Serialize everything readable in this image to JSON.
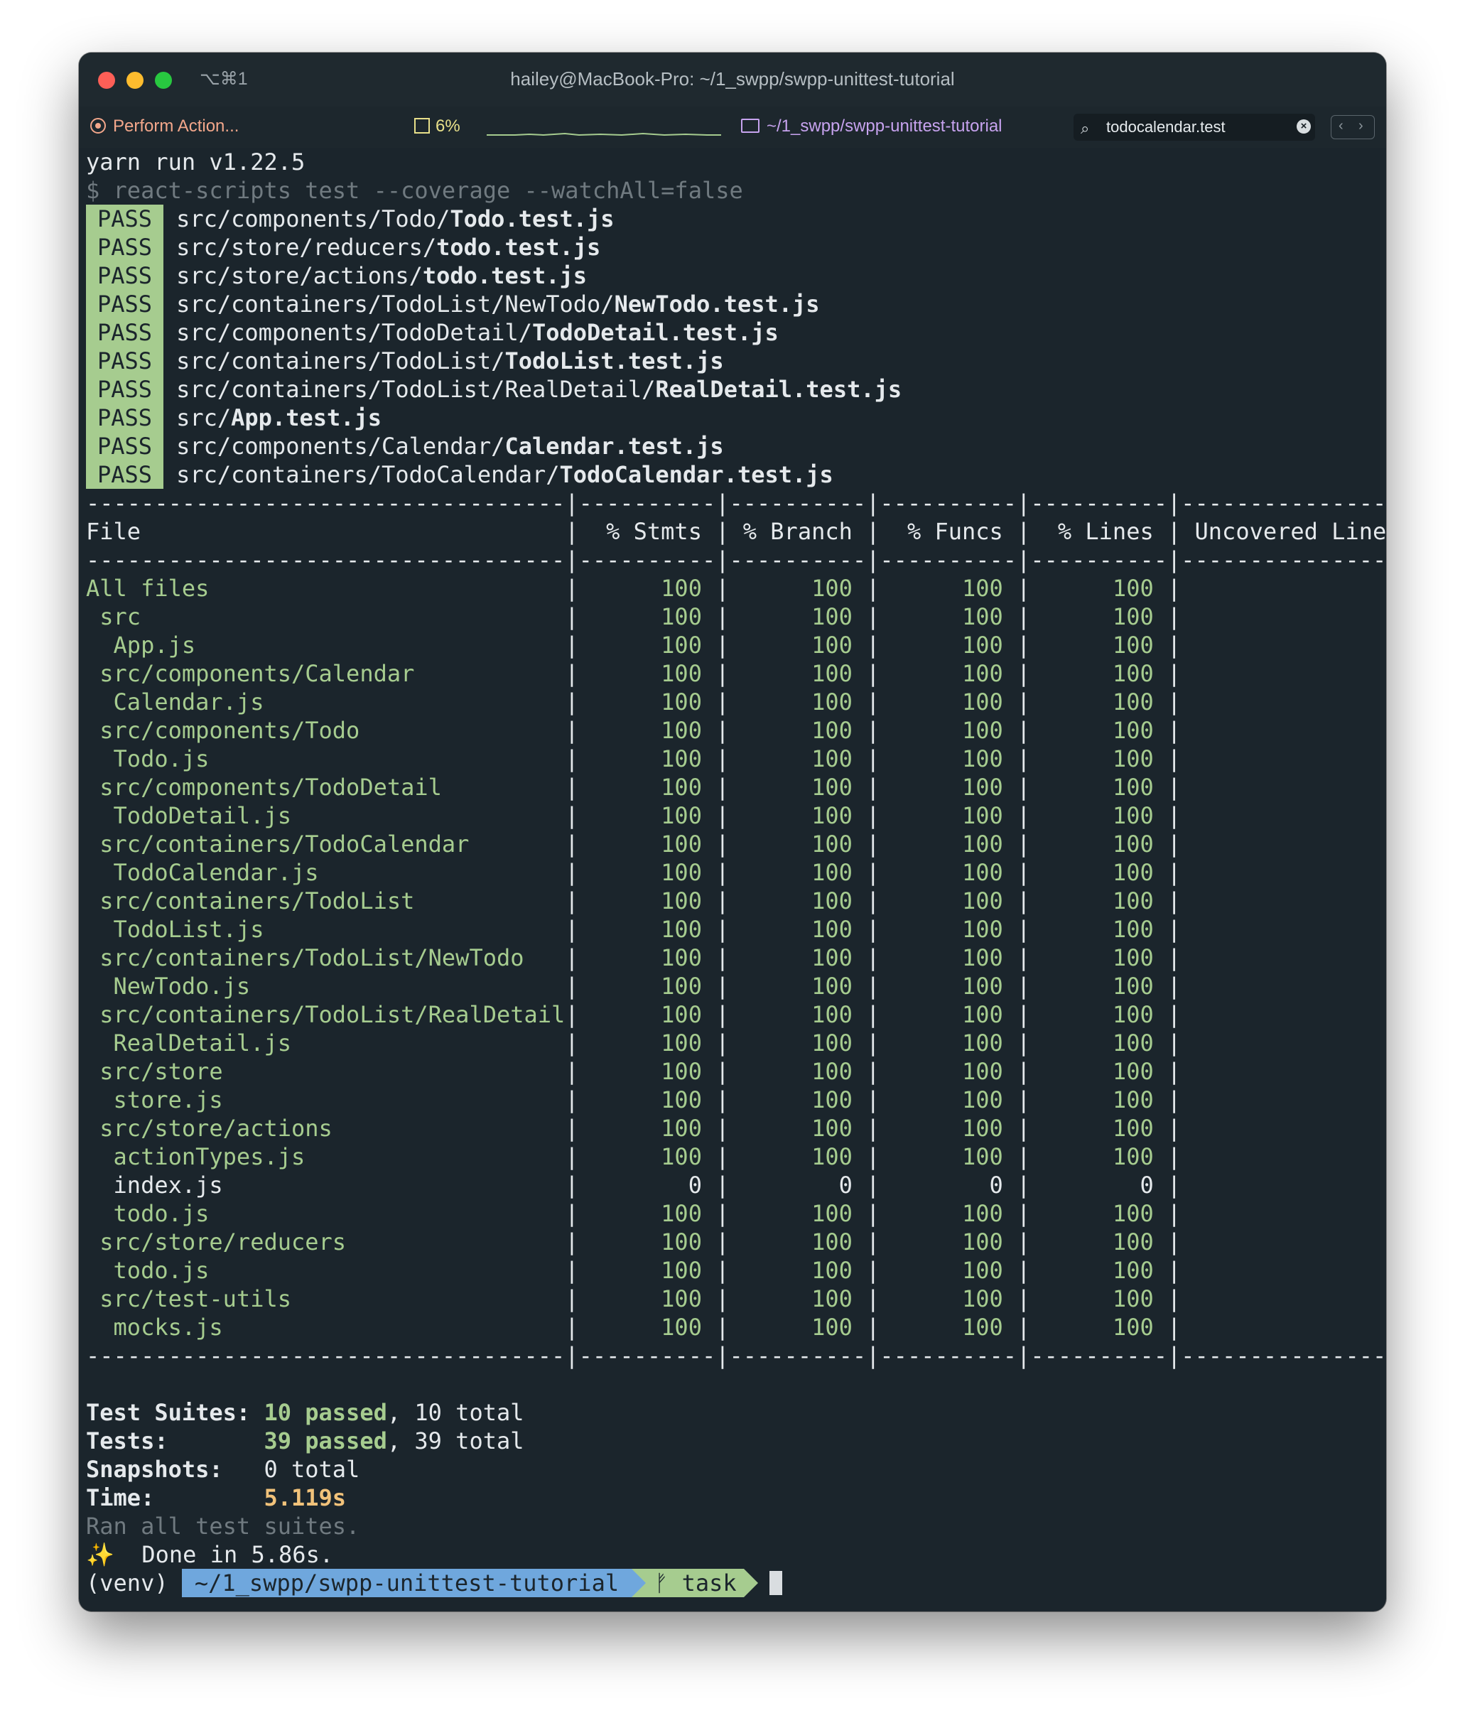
{
  "window": {
    "shortcut": "⌥⌘1",
    "title": "hailey@MacBook-Pro: ~/1_swpp/swpp-unittest-tutorial"
  },
  "statusbar": {
    "action": "Perform Action...",
    "cpu": "6%",
    "path": "~/1_swpp/swpp-unittest-tutorial",
    "search_value": "todocalendar.test"
  },
  "terminal": {
    "yarn_line": "yarn run v1.22.5",
    "command": "$ react-scripts test --coverage --watchAll=false",
    "pass_label": "PASS",
    "tests": [
      {
        "dir": "src/components/Todo/",
        "file": "Todo.test.js"
      },
      {
        "dir": "src/store/reducers/",
        "file": "todo.test.js"
      },
      {
        "dir": "src/store/actions/",
        "file": "todo.test.js"
      },
      {
        "dir": "src/containers/TodoList/NewTodo/",
        "file": "NewTodo.test.js"
      },
      {
        "dir": "src/components/TodoDetail/",
        "file": "TodoDetail.test.js"
      },
      {
        "dir": "src/containers/TodoList/",
        "file": "TodoList.test.js"
      },
      {
        "dir": "src/containers/TodoList/RealDetail/",
        "file": "RealDetail.test.js"
      },
      {
        "dir": "src/",
        "file": "App.test.js"
      },
      {
        "dir": "src/components/Calendar/",
        "file": "Calendar.test.js"
      },
      {
        "dir": "src/containers/TodoCalendar/",
        "file": "TodoCalendar.test.js"
      }
    ],
    "table": {
      "headers": [
        "File",
        "% Stmts",
        "% Branch",
        "% Funcs",
        "% Lines",
        "Uncovered Line #s"
      ],
      "rows": [
        {
          "name": "All files",
          "indent": 0,
          "v": [
            "100",
            "100",
            "100",
            "100"
          ]
        },
        {
          "name": "src",
          "indent": 1,
          "v": [
            "100",
            "100",
            "100",
            "100"
          ]
        },
        {
          "name": "App.js",
          "indent": 2,
          "v": [
            "100",
            "100",
            "100",
            "100"
          ]
        },
        {
          "name": "src/components/Calendar",
          "indent": 1,
          "v": [
            "100",
            "100",
            "100",
            "100"
          ]
        },
        {
          "name": "Calendar.js",
          "indent": 2,
          "v": [
            "100",
            "100",
            "100",
            "100"
          ]
        },
        {
          "name": "src/components/Todo",
          "indent": 1,
          "v": [
            "100",
            "100",
            "100",
            "100"
          ]
        },
        {
          "name": "Todo.js",
          "indent": 2,
          "v": [
            "100",
            "100",
            "100",
            "100"
          ]
        },
        {
          "name": "src/components/TodoDetail",
          "indent": 1,
          "v": [
            "100",
            "100",
            "100",
            "100"
          ]
        },
        {
          "name": "TodoDetail.js",
          "indent": 2,
          "v": [
            "100",
            "100",
            "100",
            "100"
          ]
        },
        {
          "name": "src/containers/TodoCalendar",
          "indent": 1,
          "v": [
            "100",
            "100",
            "100",
            "100"
          ]
        },
        {
          "name": "TodoCalendar.js",
          "indent": 2,
          "v": [
            "100",
            "100",
            "100",
            "100"
          ]
        },
        {
          "name": "src/containers/TodoList",
          "indent": 1,
          "v": [
            "100",
            "100",
            "100",
            "100"
          ]
        },
        {
          "name": "TodoList.js",
          "indent": 2,
          "v": [
            "100",
            "100",
            "100",
            "100"
          ]
        },
        {
          "name": "src/containers/TodoList/NewTodo",
          "indent": 1,
          "v": [
            "100",
            "100",
            "100",
            "100"
          ]
        },
        {
          "name": "NewTodo.js",
          "indent": 2,
          "v": [
            "100",
            "100",
            "100",
            "100"
          ]
        },
        {
          "name": "src/containers/TodoList/RealDetail",
          "indent": 1,
          "v": [
            "100",
            "100",
            "100",
            "100"
          ]
        },
        {
          "name": "RealDetail.js",
          "indent": 2,
          "v": [
            "100",
            "100",
            "100",
            "100"
          ]
        },
        {
          "name": "src/store",
          "indent": 1,
          "v": [
            "100",
            "100",
            "100",
            "100"
          ]
        },
        {
          "name": "store.js",
          "indent": 2,
          "v": [
            "100",
            "100",
            "100",
            "100"
          ]
        },
        {
          "name": "src/store/actions",
          "indent": 1,
          "v": [
            "100",
            "100",
            "100",
            "100"
          ]
        },
        {
          "name": "actionTypes.js",
          "indent": 2,
          "v": [
            "100",
            "100",
            "100",
            "100"
          ]
        },
        {
          "name": "index.js",
          "indent": 2,
          "v": [
            "0",
            "0",
            "0",
            "0"
          ]
        },
        {
          "name": "todo.js",
          "indent": 2,
          "v": [
            "100",
            "100",
            "100",
            "100"
          ]
        },
        {
          "name": "src/store/reducers",
          "indent": 1,
          "v": [
            "100",
            "100",
            "100",
            "100"
          ]
        },
        {
          "name": "todo.js",
          "indent": 2,
          "v": [
            "100",
            "100",
            "100",
            "100"
          ]
        },
        {
          "name": "src/test-utils",
          "indent": 1,
          "v": [
            "100",
            "100",
            "100",
            "100"
          ]
        },
        {
          "name": "mocks.js",
          "indent": 2,
          "v": [
            "100",
            "100",
            "100",
            "100"
          ]
        }
      ]
    },
    "summary": {
      "suites_label": "Test Suites:",
      "suites_passed": "10 passed",
      "suites_total": ", 10 total",
      "tests_label": "Tests:",
      "tests_passed": "39 passed",
      "tests_total": ", 39 total",
      "snapshots_label": "Snapshots:",
      "snapshots_value": "0 total",
      "time_label": "Time:",
      "time_value": "5.119s",
      "ran_all": "Ran all test suites.",
      "done": "Done in 5.86s."
    },
    "prompt": {
      "venv": "(venv)",
      "path": "~/1_swpp/swpp-unittest-tutorial",
      "branch": "task"
    }
  },
  "colors": {
    "background": "#1b252c",
    "pass_badge": "#a6cc8f",
    "prompt_path": "#6fa7dd",
    "time": "#f1c27a"
  }
}
